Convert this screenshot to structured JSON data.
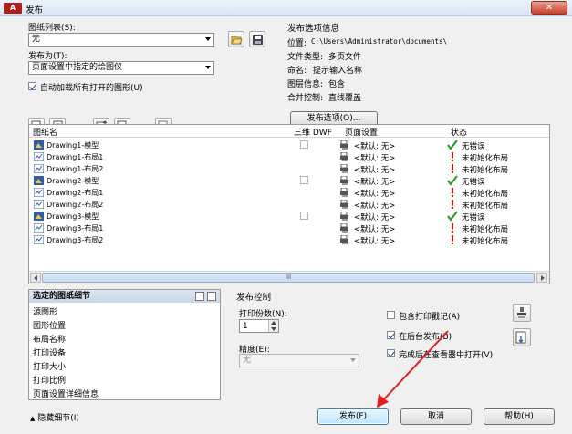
{
  "window": {
    "title": "发布",
    "logo": "A",
    "close": "✕"
  },
  "sheet_list": {
    "label": "图纸列表(S):",
    "value": "无"
  },
  "publish_to": {
    "label": "发布为(T):",
    "value": "页面设置中指定的绘图仪"
  },
  "auto_load": {
    "label": "自动加载所有打开的图形(U)",
    "checked": true
  },
  "options_info": {
    "title": "发布选项信息",
    "rows": [
      {
        "k": "位置:",
        "v": "C:\\Users\\Administrator\\documents\\"
      },
      {
        "k": "文件类型:",
        "v": "多页文件"
      },
      {
        "k": "命名:",
        "v": "提示输入名称"
      },
      {
        "k": "图层信息:",
        "v": "包含"
      },
      {
        "k": "合并控制:",
        "v": "直线覆盖"
      }
    ],
    "button": "发布选项(O)..."
  },
  "table": {
    "headers": {
      "name": "图纸名",
      "dwf": "三维 DWF",
      "page_setup": "页面设置",
      "status": "状态"
    },
    "rows": [
      {
        "name": "Drawing1-模型",
        "type": "model",
        "page": "<默认: 无>",
        "status": "无错误",
        "ok": true,
        "dwf": true
      },
      {
        "name": "Drawing1-布局1",
        "type": "layout",
        "page": "<默认: 无>",
        "status": "未初始化布局",
        "ok": false,
        "dwf": false
      },
      {
        "name": "Drawing1-布局2",
        "type": "layout",
        "page": "<默认: 无>",
        "status": "未初始化布局",
        "ok": false,
        "dwf": false
      },
      {
        "name": "Drawing2-模型",
        "type": "model",
        "page": "<默认: 无>",
        "status": "无错误",
        "ok": true,
        "dwf": true
      },
      {
        "name": "Drawing2-布局1",
        "type": "layout",
        "page": "<默认: 无>",
        "status": "未初始化布局",
        "ok": false,
        "dwf": false
      },
      {
        "name": "Drawing2-布局2",
        "type": "layout",
        "page": "<默认: 无>",
        "status": "未初始化布局",
        "ok": false,
        "dwf": false
      },
      {
        "name": "Drawing3-模型",
        "type": "model",
        "page": "<默认: 无>",
        "status": "无错误",
        "ok": true,
        "dwf": true
      },
      {
        "name": "Drawing3-布局1",
        "type": "layout",
        "page": "<默认: 无>",
        "status": "未初始化布局",
        "ok": false,
        "dwf": false
      },
      {
        "name": "Drawing3-布局2",
        "type": "layout",
        "page": "<默认: 无>",
        "status": "未初始化布局",
        "ok": false,
        "dwf": false
      }
    ],
    "scroll_grip": "III"
  },
  "details": {
    "title": "选定的图纸细节",
    "items": [
      "源图形",
      "图形位置",
      "布局名称",
      "打印设备",
      "打印大小",
      "打印比例",
      "页面设置详细信息"
    ]
  },
  "publish_control": {
    "title": "发布控制",
    "copies_label": "打印份数(N):",
    "copies_value": "1",
    "precision_label": "精度(E):",
    "precision_value": "无",
    "options": [
      {
        "label": "包含打印戳记(A)",
        "checked": false
      },
      {
        "label": "在后台发布(B)",
        "checked": true
      },
      {
        "label": "完成后在查看器中打开(V)",
        "checked": true
      }
    ]
  },
  "footer": {
    "hide_details": "隐藏细节(I)",
    "hide_arrow": "▲",
    "publish": "发布(F)",
    "cancel": "取消",
    "help": "帮助(H)"
  },
  "colors": {
    "ok": "#2e9a2e",
    "warn": "#d01010",
    "annotation_arrow": "#e02020"
  }
}
